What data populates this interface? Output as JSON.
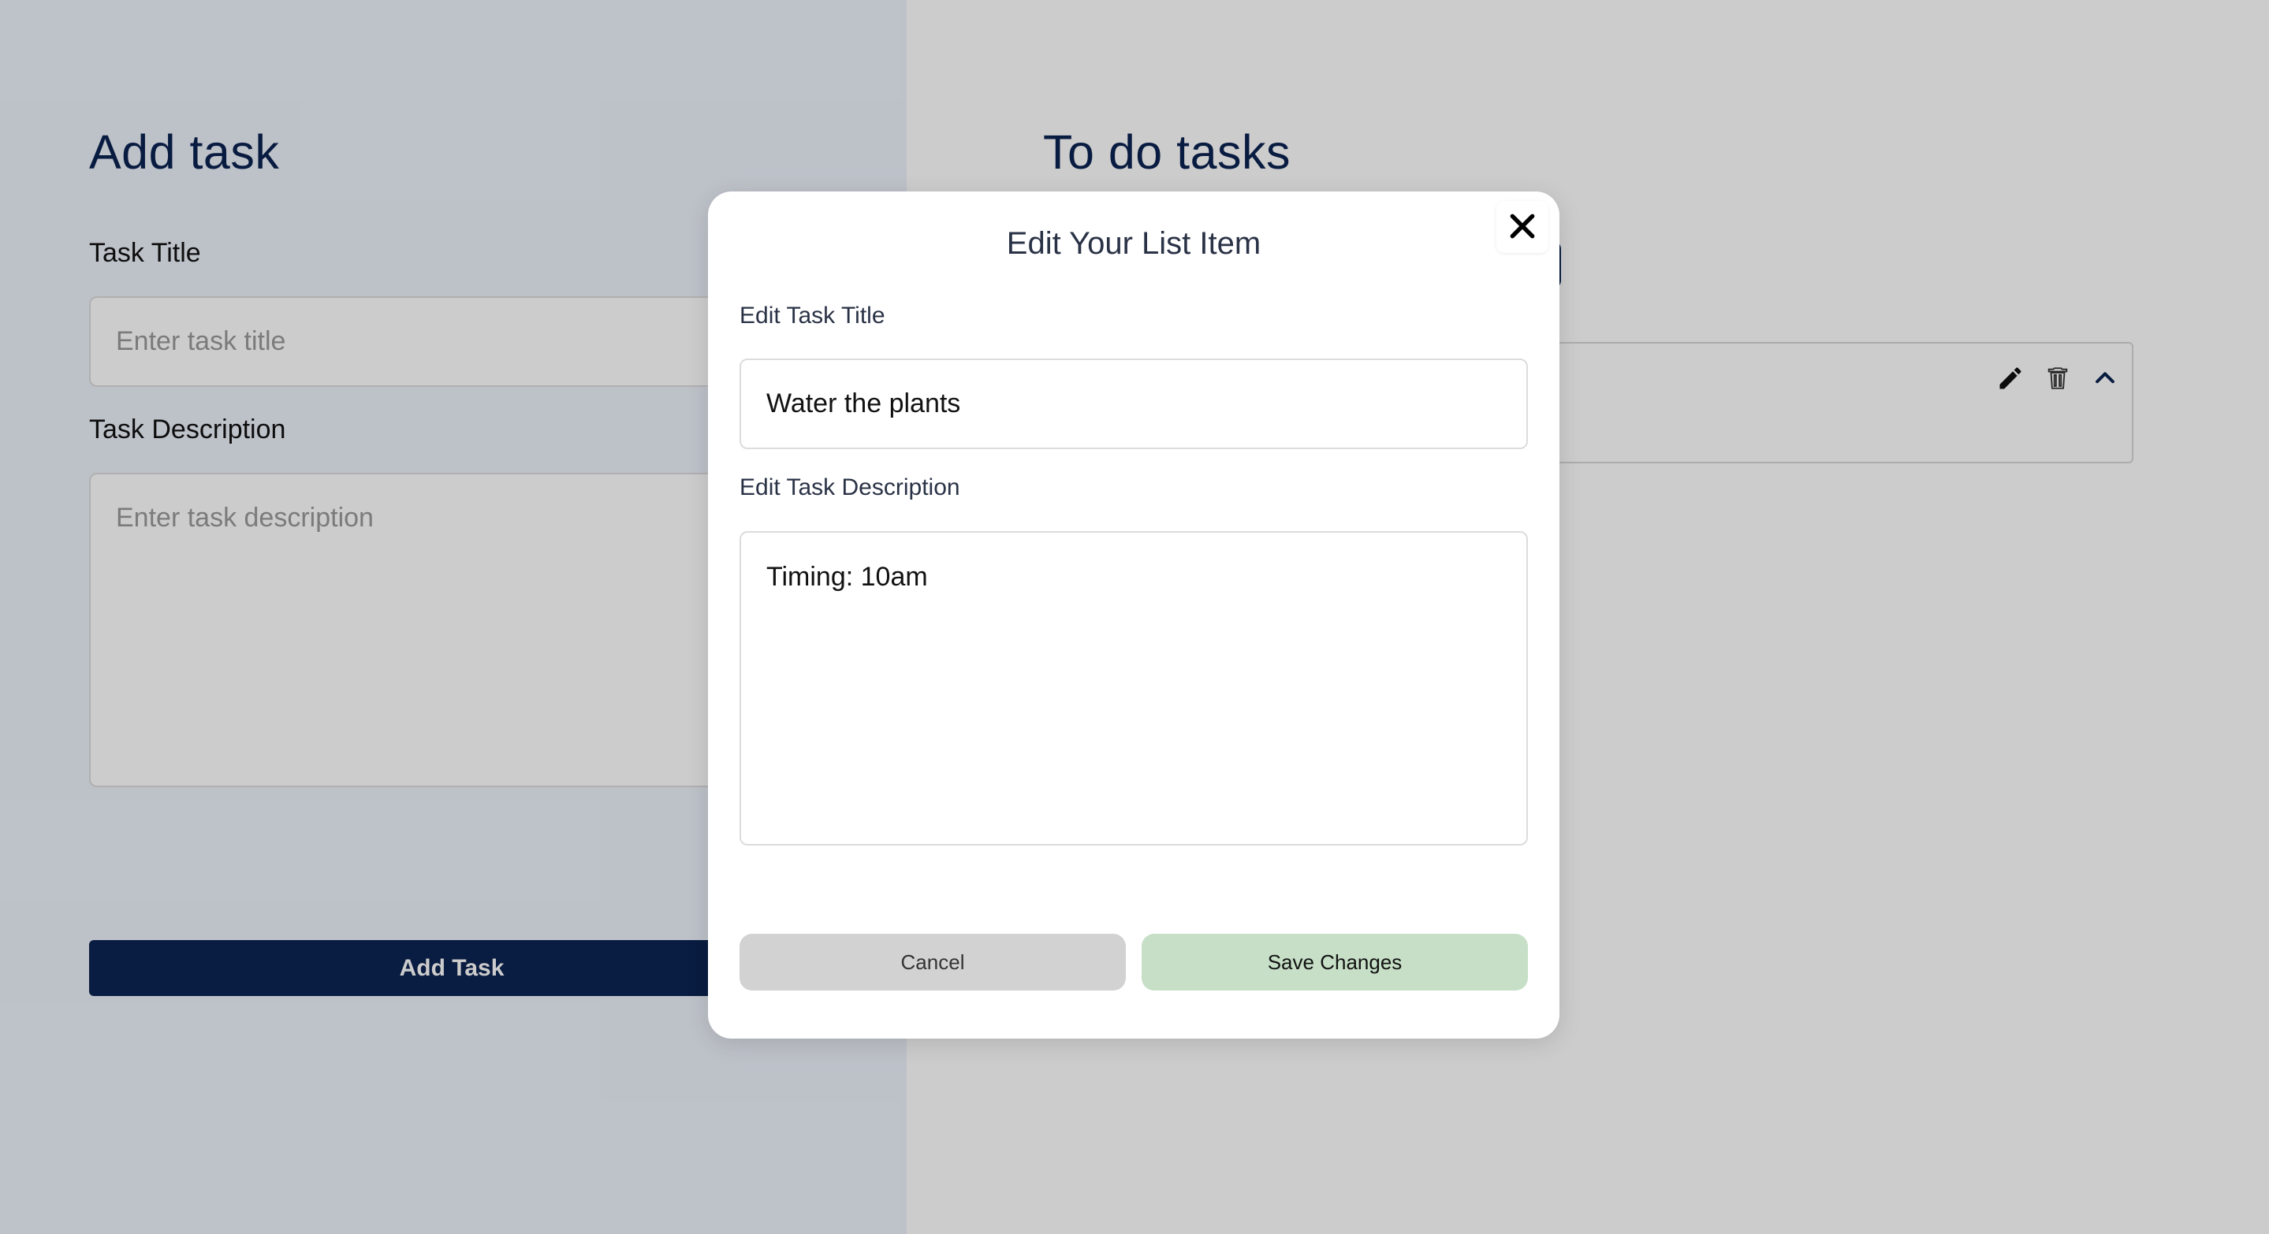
{
  "add_panel": {
    "heading": "Add task",
    "title_label": "Task Title",
    "title_placeholder": "Enter task title",
    "description_label": "Task Description",
    "description_placeholder": "Enter task description",
    "add_button_label": "Add Task"
  },
  "list_panel": {
    "heading": "To do tasks"
  },
  "edit_modal": {
    "title": "Edit Your List Item",
    "title_field_label": "Edit Task Title",
    "title_field_value": "Water the plants",
    "description_field_label": "Edit Task Description",
    "description_field_value": "Timing: 10am",
    "cancel_label": "Cancel",
    "save_label": "Save Changes"
  },
  "icons": {
    "close": "close-icon",
    "edit": "pencil-icon",
    "delete": "trash-icon",
    "collapse": "chevron-up-icon"
  },
  "colors": {
    "brand": "#0c2352",
    "save": "#c6dfc6",
    "cancel": "#d2d2d2"
  }
}
